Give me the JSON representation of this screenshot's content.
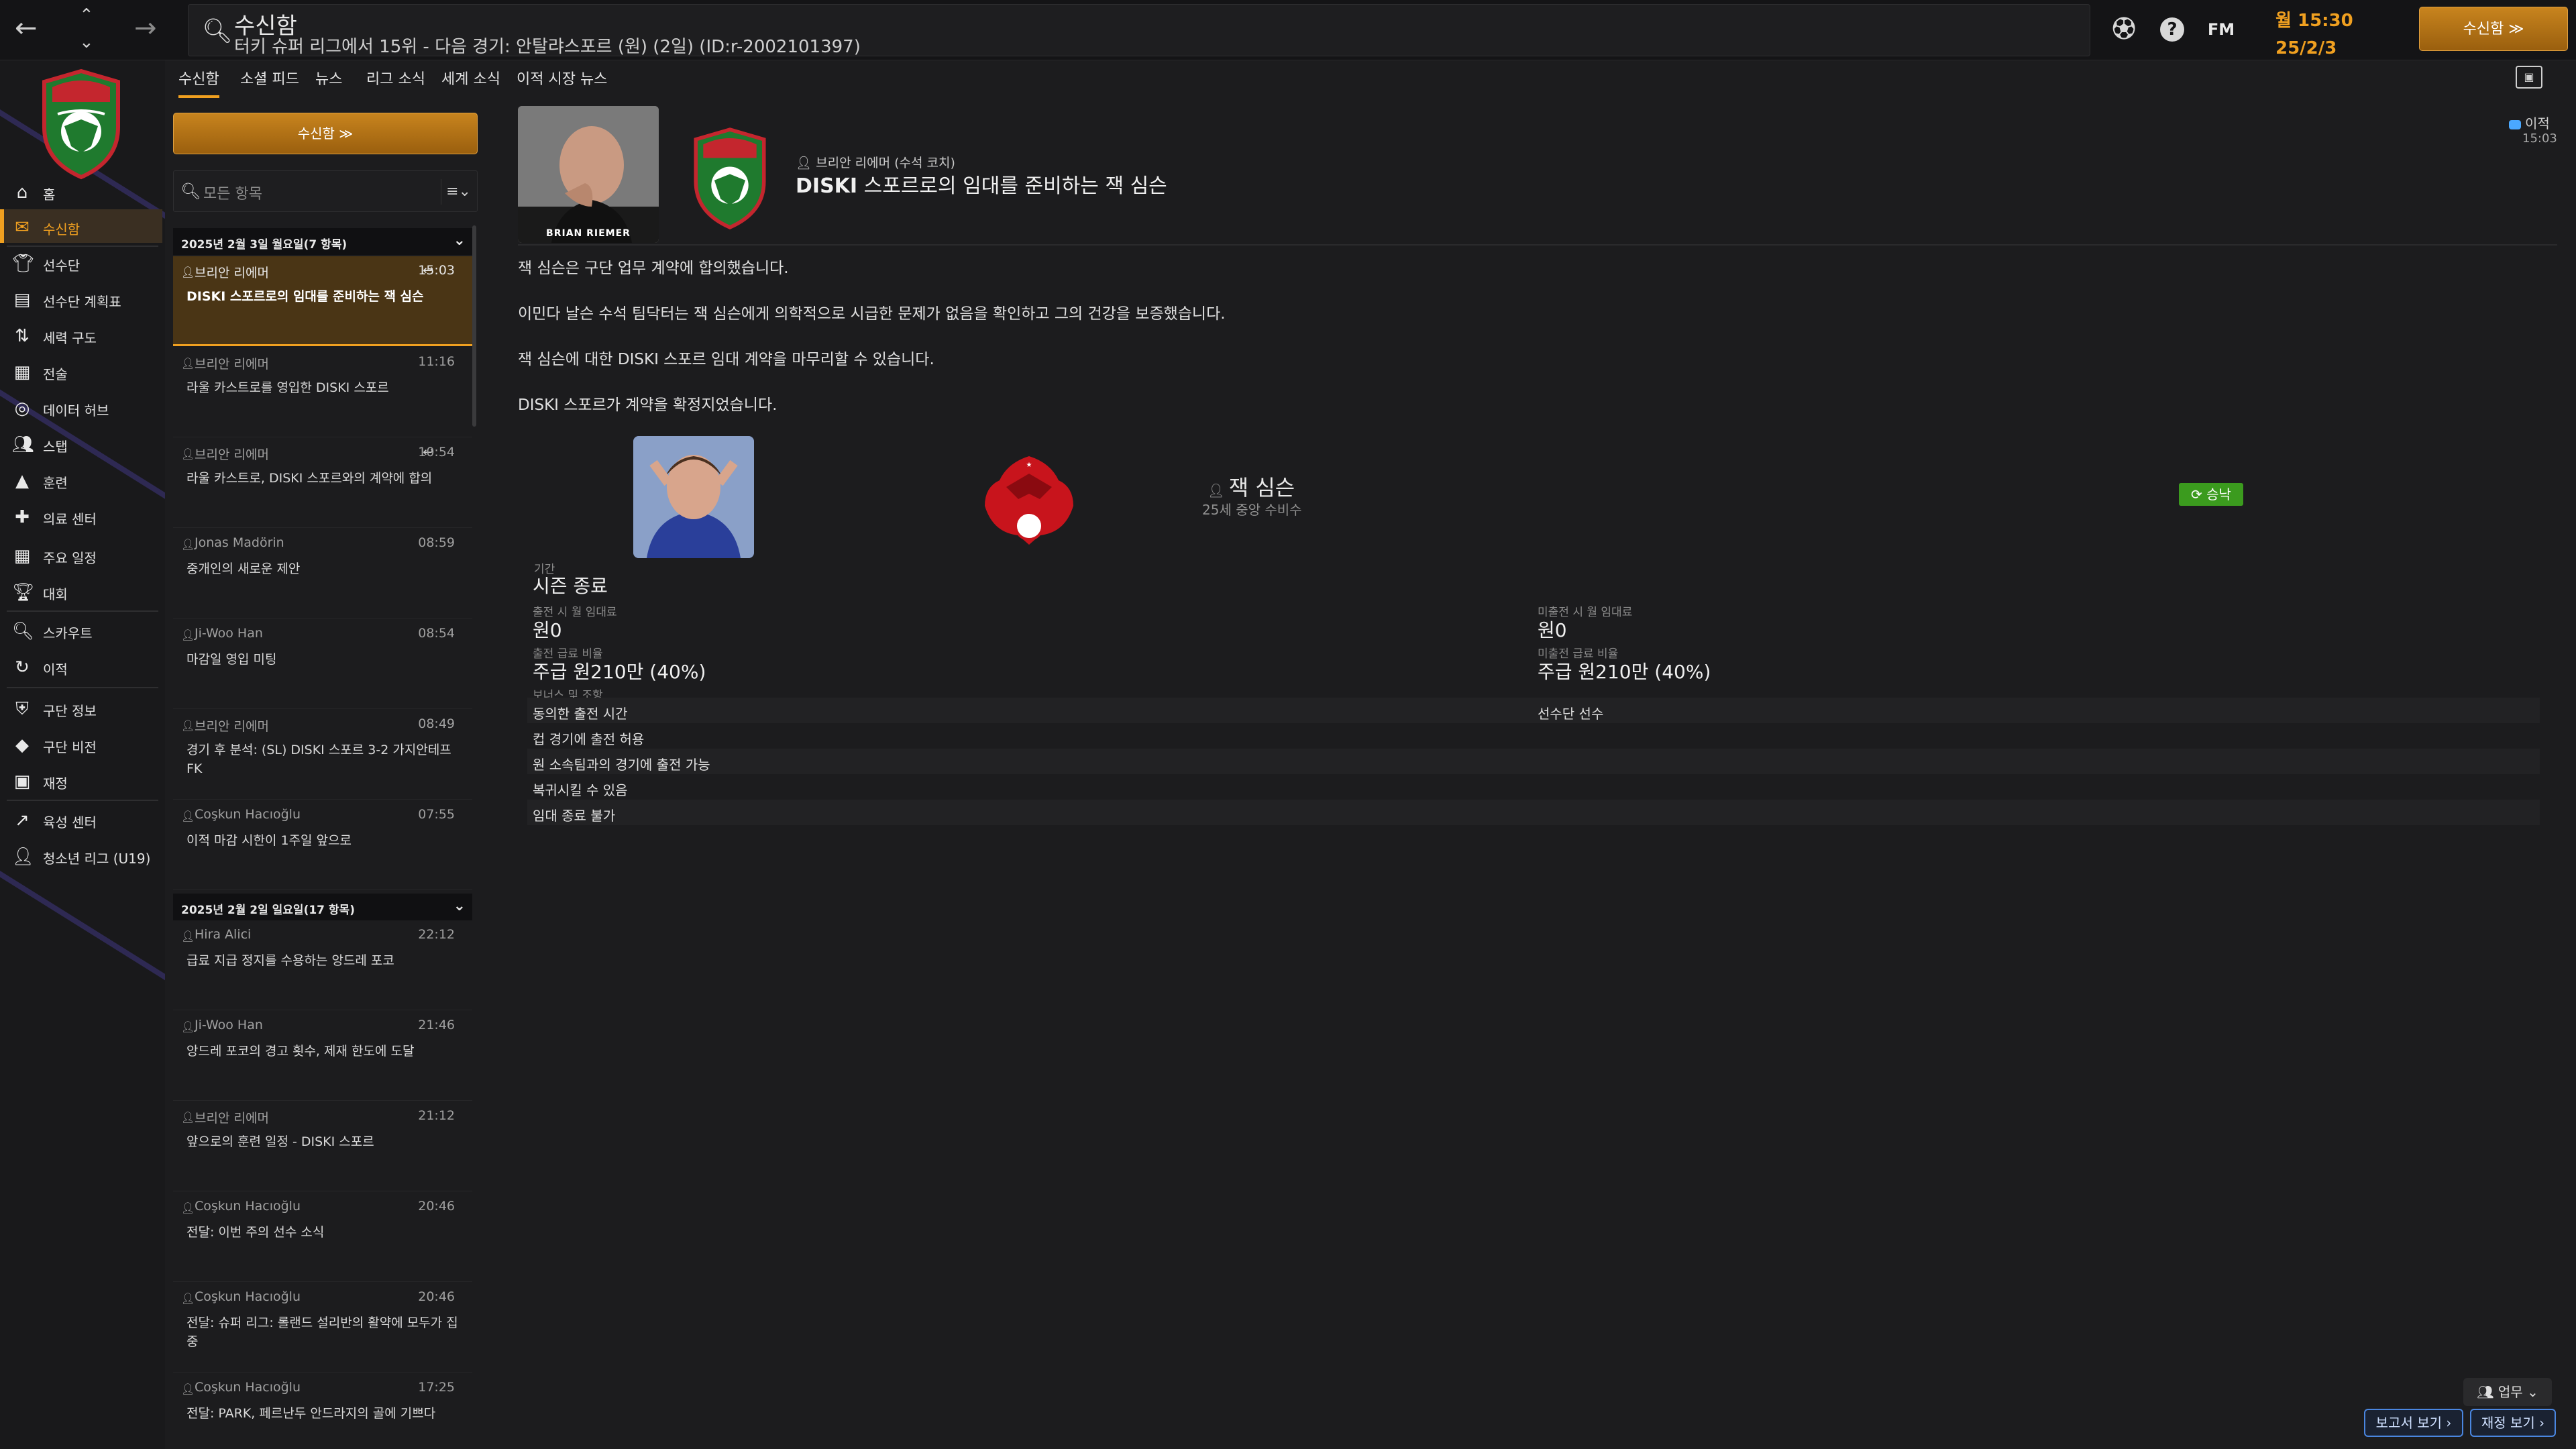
{
  "topbar": {
    "title": "수신함",
    "subtitle": "터키 슈퍼 리그에서 15위 - 다음 경기: 안탈랴스포르 (원) (2일) (ID:r-2002101397)",
    "time": "월 15:30",
    "date": "25/2/3",
    "continue_label": "수신함 ≫",
    "fm_label": "FM"
  },
  "sidebar": {
    "items": [
      {
        "label": "홈",
        "icon": "⌂"
      },
      {
        "label": "수신함",
        "icon": "✉"
      },
      {
        "label": "선수단",
        "icon": "👕"
      },
      {
        "label": "선수단 계획표",
        "icon": "▤"
      },
      {
        "label": "세력 구도",
        "icon": "⇅"
      },
      {
        "label": "전술",
        "icon": "▦"
      },
      {
        "label": "데이터 허브",
        "icon": "◎"
      },
      {
        "label": "스탭",
        "icon": "👥"
      },
      {
        "label": "훈련",
        "icon": "▲"
      },
      {
        "label": "의료 센터",
        "icon": "✚"
      },
      {
        "label": "주요 일정",
        "icon": "▦"
      },
      {
        "label": "대회",
        "icon": "🏆"
      },
      {
        "label": "스카우트",
        "icon": "🔍"
      },
      {
        "label": "이적",
        "icon": "↻"
      },
      {
        "label": "구단 정보",
        "icon": "⛨"
      },
      {
        "label": "구단 비전",
        "icon": "◆"
      },
      {
        "label": "재정",
        "icon": "▣"
      },
      {
        "label": "육성 센터",
        "icon": "↗"
      },
      {
        "label": "청소년 리그 (U19)",
        "icon": "👤"
      }
    ]
  },
  "tabs": [
    "수신함",
    "소셜 피드",
    "뉴스",
    "리그 소식",
    "세계 소식",
    "이적 시장 뉴스"
  ],
  "list": {
    "continue_label": "수신함 ≫",
    "filter_placeholder": "모든 항목",
    "filter_button": "≡⌄",
    "groups": [
      {
        "header": "2025년 2월 3일 월요일(7 항목)"
      },
      {
        "header": "2025년 2월 2일 일요일(17 항목)"
      }
    ],
    "messages": [
      {
        "sender": "브리안 리에머",
        "time": "15:03",
        "subject": "DISKI 스포르로의 임대를 준비하는 잭 심슨",
        "reply": "↩"
      },
      {
        "sender": "브리안 리에머",
        "time": "11:16",
        "subject": "라울 카스트로를 영입한 DISKI 스포르",
        "reply": ""
      },
      {
        "sender": "브리안 리에머",
        "time": "10:54",
        "subject": "라울 카스트로, DISKI 스포르와의 계약에 합의",
        "reply": "↩"
      },
      {
        "sender": "Jonas Madörin",
        "time": "08:59",
        "subject": "중개인의 새로운 제안",
        "reply": ""
      },
      {
        "sender": "Ji-Woo Han",
        "time": "08:54",
        "subject": "마감일 영입 미팅",
        "reply": ""
      },
      {
        "sender": "브리안 리에머",
        "time": "08:49",
        "subject": "경기 후 분석: (SL) DISKI 스포르 3-2 가지안테프 FK",
        "reply": ""
      },
      {
        "sender": "Coşkun Hacıoğlu",
        "time": "07:55",
        "subject": "이적 마감 시한이 1주일 앞으로",
        "reply": ""
      },
      {
        "sender": "Hira Alici",
        "time": "22:12",
        "subject": "급료 지급 정지를 수용하는 앙드레 포코",
        "reply": ""
      },
      {
        "sender": "Ji-Woo Han",
        "time": "21:46",
        "subject": "앙드레 포코의 경고 횟수, 제재 한도에 도달",
        "reply": ""
      },
      {
        "sender": "브리안 리에머",
        "time": "21:12",
        "subject": "앞으로의 훈련 일정 - DISKI 스포르",
        "reply": ""
      },
      {
        "sender": "Coşkun Hacıoğlu",
        "time": "20:46",
        "subject": "전달: 이번 주의 선수 소식",
        "reply": ""
      },
      {
        "sender": "Coşkun Hacıoğlu",
        "time": "20:46",
        "subject": "전달: 슈퍼 리그: 롤랜드 설리반의 활약에 모두가 집중",
        "reply": ""
      },
      {
        "sender": "Coşkun Hacıoğlu",
        "time": "17:25",
        "subject": "전달: PARK, 페르난두 안드라지의 골에 기쁘다",
        "reply": ""
      }
    ]
  },
  "message": {
    "coach_name_tag": "BRIAN RIEMER",
    "sender": "브리안 리에머 (수석 코치)",
    "subject_bold": "DISKI",
    "subject_rest": " 스포르로의 임대를 준비하는 잭 심슨",
    "status_label": "이적",
    "status_time": "15:03",
    "paragraphs": [
      "잭 심슨은 구단 업무 계약에 합의했습니다.",
      "이민다 날슨 수석 팀닥터는 잭 심슨에게 의학적으로 시급한 문제가 없음을 확인하고 그의 건강을 보증했습니다.",
      "잭 심슨에 대한 DISKI 스포르 임대 계약을 마무리할 수 있습니다.",
      "DISKI 스포르가 계약을 확정지었습니다."
    ],
    "player_name": "잭 심슨",
    "player_desc": "25세 중앙 수비수",
    "approve_label": "승낙",
    "details": {
      "period_label": "기간",
      "period_value": "시즌 종료",
      "monthly_fee_play_label": "출전 시 월 임대료",
      "monthly_fee_play_value": "원0",
      "monthly_fee_noplay_label": "미출전 시 월 임대료",
      "monthly_fee_noplay_value": "원0",
      "wage_play_label": "출전 급료 비율",
      "wage_play_value": "주급 원210만 (40%)",
      "wage_noplay_label": "미출전 급료 비율",
      "wage_noplay_value": "주급 원210만 (40%)",
      "clauses_label": "보너스 및 조항"
    },
    "clauses": [
      {
        "left": "동의한 출전 시간",
        "right": "선수단 선수"
      },
      {
        "left": "컵 경기에 출전 허용",
        "right": ""
      },
      {
        "left": "원 소속팀과의 경기에 출전 가능",
        "right": ""
      },
      {
        "left": "복귀시킬 수 있음",
        "right": ""
      },
      {
        "left": "임대 종료 불가",
        "right": ""
      }
    ]
  },
  "bottom": {
    "dropdown_label": "업무 ⌄",
    "report_label": "보고서 보기 ›",
    "finance_label": "재정 보기 ›"
  },
  "colors": {
    "accent": "#f0a020",
    "approve": "#3b9b1e",
    "background": "#1c1c1e"
  }
}
